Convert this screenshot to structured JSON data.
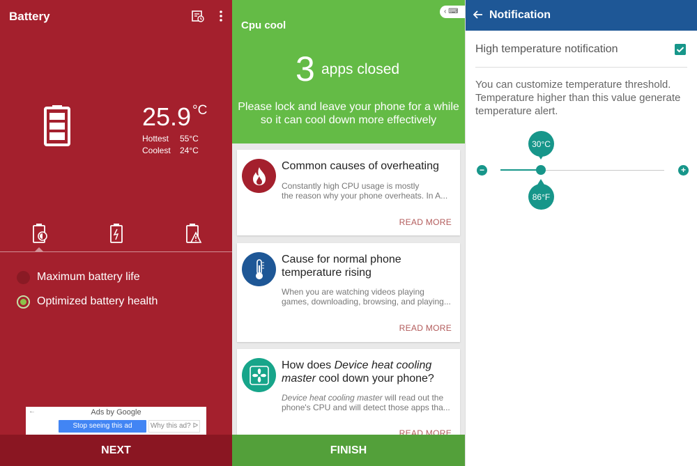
{
  "colors": {
    "battery_bg": "#a4202d",
    "battery_bar": "#8a1622",
    "cpu_green": "#64bb46",
    "cpu_finish": "#53a03a",
    "notif_appbar": "#1e5796",
    "teal": "#17968a",
    "read_more": "#b25a5a"
  },
  "battery": {
    "title": "Battery",
    "icons": [
      "schedule-icon",
      "more-vert-icon",
      "battery-full-icon"
    ],
    "temperature": "25.9",
    "unit": "°C",
    "hottest_label": "Hottest",
    "hottest_value": "55°C",
    "coolest_label": "Coolest",
    "coolest_value": "24°C",
    "tabs": [
      "battery-saver-tab-icon",
      "battery-charging-tab-icon",
      "battery-alert-tab-icon"
    ],
    "selected_tab": 0,
    "options": [
      {
        "label": "Maximum battery life",
        "selected": false
      },
      {
        "label": "Optimized battery health",
        "selected": true
      }
    ],
    "ad": {
      "heading": "Ads by Google",
      "stop_label": "Stop seeing this ad",
      "why_label": "Why this ad? ᐅ"
    },
    "next_label": "NEXT"
  },
  "cpu": {
    "title": "Cpu cool",
    "keyboard_badge": "‹ ⌨",
    "apps_closed_count": "3",
    "apps_closed_label": "apps closed",
    "message": "Please lock and leave your phone for a while so it can cool down more effectively",
    "cards": [
      {
        "icon": "flame-icon",
        "title": "Common causes of overheating",
        "body_1": "Constantly high CPU usage is mostly",
        "body_2": "the reason why your phone overheats. In A...",
        "read_more": "READ MORE"
      },
      {
        "icon": "thermometer-icon",
        "title": "Cause for normal phone temperature rising",
        "body_1": "When you are watching videos playing",
        "body_2": "games, downloading, browsing, and playing...",
        "read_more": "READ MORE"
      },
      {
        "icon": "fan-icon",
        "title_pre": "How does ",
        "title_em": "Device heat cooling master",
        "title_post": " cool down your phone?",
        "body_em": "Device heat cooling master",
        "body_1_post": " will read out the",
        "body_2": "phone's CPU and will detect those apps tha...",
        "read_more": "READ MORE"
      }
    ],
    "finish_label": "FINISH"
  },
  "notification": {
    "title": "Notification",
    "high_temp_label": "High temperature notification",
    "high_temp_checked": true,
    "description": "You can customize temperature threshold. Temperature higher than this value generate temperature alert.",
    "threshold_c": "30°C",
    "threshold_f": "86°F",
    "slider_fraction": 0.25
  }
}
